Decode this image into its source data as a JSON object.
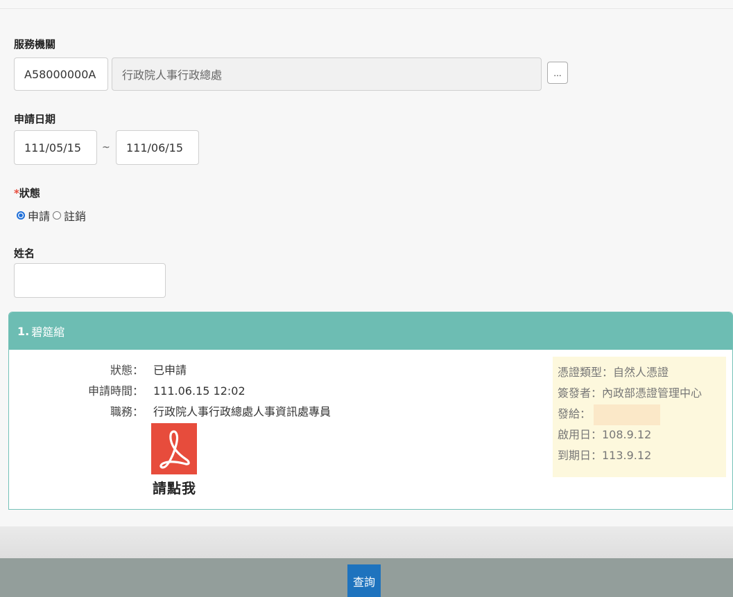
{
  "form": {
    "agency_label": "服務機關",
    "agency_code": "A58000000A",
    "agency_name": "行政院人事行政總處",
    "lookup_button": "...",
    "date_label": "申請日期",
    "date_from": "111/05/15",
    "date_sep": "~",
    "date_to": "111/06/15",
    "status_required_mark": "*",
    "status_label": "狀態",
    "status_options": [
      {
        "label": "申請",
        "checked": true
      },
      {
        "label": "註銷",
        "checked": false
      }
    ],
    "name_label": "姓名",
    "name_value": ""
  },
  "result": {
    "index": "1.",
    "name": "碧筵綰",
    "fields": [
      {
        "key": "狀態：",
        "value": "已申請"
      },
      {
        "key": "申請時間：",
        "value": "111.06.15 12:02"
      },
      {
        "key": "職務：",
        "value": "行政院人事行政總處人事資訊處專員"
      }
    ],
    "pdf_icon": "pdf-icon",
    "pdf_caption": "請點我",
    "cert": {
      "type": "憑證類型：自然人憑證",
      "issuer": "簽發者：內政部憑證管理中心",
      "issued_to": "發給：",
      "start": "啟用日：108.9.12",
      "expire": "到期日：113.9.12"
    }
  },
  "footer": {
    "query_button": "查詢"
  },
  "colors": {
    "panel_header": "#6dbdb3",
    "pdf_red": "#e74c3c",
    "button_blue": "#1e73be"
  }
}
